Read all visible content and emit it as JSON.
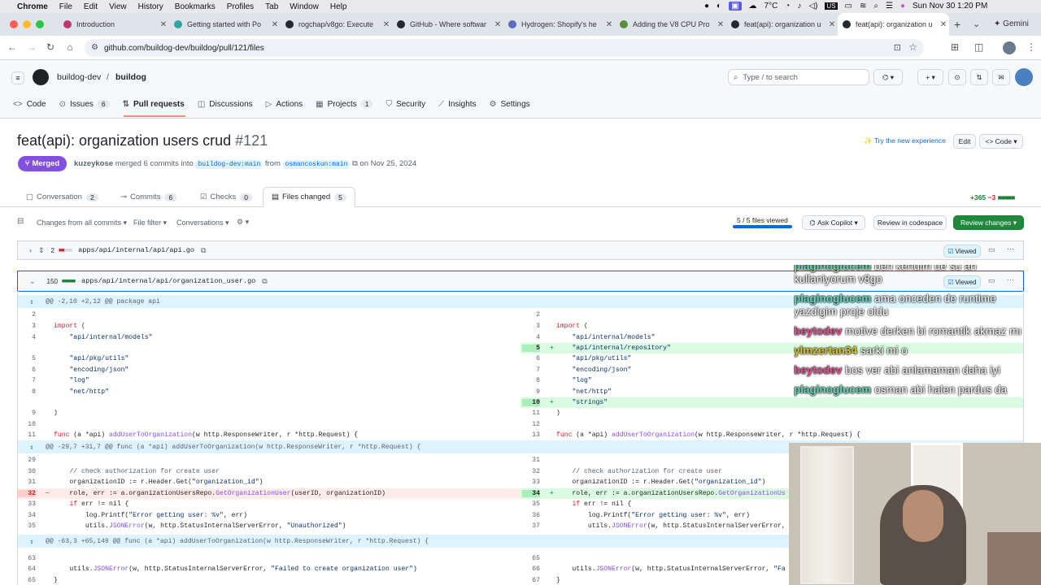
{
  "menubar": {
    "app": "Chrome",
    "items": [
      "File",
      "Edit",
      "View",
      "History",
      "Bookmarks",
      "Profiles",
      "Tab",
      "Window",
      "Help"
    ],
    "status": {
      "weather": "7°C",
      "clock": "Sun Nov 30  1:20 PM"
    }
  },
  "tabs": [
    {
      "title": "Introduction",
      "color": "#c4346c"
    },
    {
      "title": "Getting started with Po",
      "color": "#2ea3a0"
    },
    {
      "title": "rogchap/v8go: Execute",
      "color": "#24292f"
    },
    {
      "title": "GitHub - Where softwar",
      "color": "#24292f"
    },
    {
      "title": "Hydrogen: Shopify's he",
      "color": "#5c6ac4"
    },
    {
      "title": "Adding the V8 CPU Pro",
      "color": "#5a8f3b"
    },
    {
      "title": "feat(api): organization u",
      "color": "#24292f"
    },
    {
      "title": "feat(api): organization u",
      "color": "#24292f"
    }
  ],
  "browser": {
    "url": "github.com/buildog-dev/buildog/pull/121/files",
    "gemini": "Gemini"
  },
  "repo": {
    "owner": "buildog-dev",
    "name": "buildog",
    "search_label": "Type / to search",
    "search_kbd": "/"
  },
  "repo_nav": [
    {
      "icon": "<>",
      "label": "Code",
      "count": ""
    },
    {
      "icon": "⊙",
      "label": "Issues",
      "count": "6"
    },
    {
      "icon": "⇅",
      "label": "Pull requests",
      "count": ""
    },
    {
      "icon": "◫",
      "label": "Discussions",
      "count": ""
    },
    {
      "icon": "▷",
      "label": "Actions",
      "count": ""
    },
    {
      "icon": "▦",
      "label": "Projects",
      "count": "1"
    },
    {
      "icon": "⛉",
      "label": "Security",
      "count": ""
    },
    {
      "icon": "⟋",
      "label": "Insights",
      "count": ""
    },
    {
      "icon": "⚙",
      "label": "Settings",
      "count": ""
    }
  ],
  "pr": {
    "title": "feat(api): organization users crud",
    "number": "#121",
    "state": "Merged",
    "author": "kuzeykose",
    "meta_text": "merged 6 commits into",
    "base": "buildog-dev:main",
    "from": "from",
    "head": "osmancoskun:main",
    "date": "on Nov 25, 2024",
    "try_new": "Try the new experience",
    "edit": "Edit",
    "code": "Code"
  },
  "pr_tabs": [
    {
      "label": "Conversation",
      "count": "2"
    },
    {
      "label": "Commits",
      "count": "6"
    },
    {
      "label": "Checks",
      "count": "0"
    },
    {
      "label": "Files changed",
      "count": "5"
    }
  ],
  "diffstat": {
    "add": "+365",
    "del": "−3"
  },
  "toolbar": {
    "changes": "Changes from all commits",
    "file_filter": "File filter",
    "conversations": "Conversations",
    "viewed": "5 / 5 files viewed",
    "viewed_fraction": 1.0,
    "ask_copilot": "Ask Copilot",
    "codespace": "Review in codespace",
    "review": "Review changes"
  },
  "files": [
    {
      "count": "2",
      "path": "apps/api/internal/api/api.go",
      "viewed": "Viewed"
    },
    {
      "count": "150",
      "path": "apps/api/internal/api/organization_user.go",
      "viewed": "Viewed"
    }
  ],
  "diff_rows": [
    {
      "type": "hunk",
      "text": "@@ -2,10 +2,12 @@ package api"
    },
    {
      "type": "ctx",
      "l": "2",
      "r": "2",
      "lt": "",
      "rt": ""
    },
    {
      "type": "ctx",
      "l": "3",
      "r": "3",
      "lt": "import (",
      "rt": "import ("
    },
    {
      "type": "ctx",
      "l": "4",
      "r": "4",
      "lt": "    \"api/internal/models\"",
      "rt": "    \"api/internal/models\""
    },
    {
      "type": "addr",
      "l": "",
      "r": "5",
      "lt": "",
      "rt": "    \"api/internal/repository\""
    },
    {
      "type": "ctx",
      "l": "5",
      "r": "6",
      "lt": "    \"api/pkg/utils\"",
      "rt": "    \"api/pkg/utils\""
    },
    {
      "type": "ctx",
      "l": "6",
      "r": "7",
      "lt": "    \"encoding/json\"",
      "rt": "    \"encoding/json\""
    },
    {
      "type": "ctx",
      "l": "7",
      "r": "8",
      "lt": "    \"log\"",
      "rt": "    \"log\""
    },
    {
      "type": "ctx",
      "l": "8",
      "r": "9",
      "lt": "    \"net/http\"",
      "rt": "    \"net/http\""
    },
    {
      "type": "addr",
      "l": "",
      "r": "10",
      "lt": "",
      "rt": "    \"strings\""
    },
    {
      "type": "ctx",
      "l": "9",
      "r": "11",
      "lt": ")",
      "rt": ")"
    },
    {
      "type": "ctx",
      "l": "10",
      "r": "12",
      "lt": "",
      "rt": ""
    },
    {
      "type": "ctx",
      "l": "11",
      "r": "13",
      "lt": "func (a *api) addUserToOrganization(w http.ResponseWriter, r *http.Request) {",
      "rt": "func (a *api) addUserToOrganization(w http.ResponseWriter, r *http.Request) {"
    },
    {
      "type": "hunk",
      "text": "@@ -29,7 +31,7 @@ func (a *api) addUserToOrganization(w http.ResponseWriter, r *http.Request) {"
    },
    {
      "type": "ctx",
      "l": "29",
      "r": "31",
      "lt": "",
      "rt": ""
    },
    {
      "type": "ctx",
      "l": "30",
      "r": "32",
      "lt": "    // check authorization for create user",
      "rt": "    // check authorization for create user"
    },
    {
      "type": "ctx",
      "l": "31",
      "r": "33",
      "lt": "    organizationID := r.Header.Get(\"organization_id\")",
      "rt": "    organizationID := r.Header.Get(\"organization_id\")"
    },
    {
      "type": "mod",
      "l": "32",
      "r": "34",
      "lt": "    role, err := a.organizationUsersRepo.GetOrganizationUser(userID, organizationID)",
      "rt": "    role, err := a.organizationUsersRepo.GetOrganizationUs"
    },
    {
      "type": "ctx",
      "l": "33",
      "r": "35",
      "lt": "    if err != nil {",
      "rt": "    if err != nil {"
    },
    {
      "type": "ctx",
      "l": "34",
      "r": "36",
      "lt": "        log.Printf(\"Error getting user: %v\", err)",
      "rt": "        log.Printf(\"Error getting user: %v\", err)"
    },
    {
      "type": "ctx",
      "l": "35",
      "r": "37",
      "lt": "        utils.JSONError(w, http.StatusInternalServerError, \"Unauthorized\")",
      "rt": "        utils.JSONError(w, http.StatusInternalServerError,"
    },
    {
      "type": "hunk",
      "text": "@@ -63,3 +65,149 @@ func (a *api) addUserToOrganization(w http.ResponseWriter, r *http.Request) {"
    },
    {
      "type": "ctx",
      "l": "63",
      "r": "65",
      "lt": "",
      "rt": ""
    },
    {
      "type": "ctx",
      "l": "64",
      "r": "66",
      "lt": "    utils.JSONError(w, http.StatusInternalServerError, \"Failed to create organization user\")",
      "rt": "    utils.JSONError(w, http.StatusInternalServerError, \"Fa"
    },
    {
      "type": "ctx",
      "l": "65",
      "r": "67",
      "lt": "}",
      "rt": "}"
    }
  ],
  "chat": [
    {
      "user": "plaginoglucem",
      "color": "#5fd7b5",
      "msg": "ben kendim de su an kullaniyorum v8go"
    },
    {
      "user": "plaginoglucem",
      "color": "#5fd7b5",
      "msg": "ama onceden de runtime yazdigim proje oldu"
    },
    {
      "user": "beytodev",
      "color": "#e0548e",
      "msg": "motive derken bi romantik akmaz mı"
    },
    {
      "user": "ylmzertan34",
      "color": "#d9c23a",
      "msg": "sarki mi o"
    },
    {
      "user": "beytodev",
      "color": "#e0548e",
      "msg": "bos ver abi anlamaman daha iyi"
    },
    {
      "user": "plaginoglucem",
      "color": "#5fd7b5",
      "msg": "osman abi halen pardus da"
    }
  ]
}
